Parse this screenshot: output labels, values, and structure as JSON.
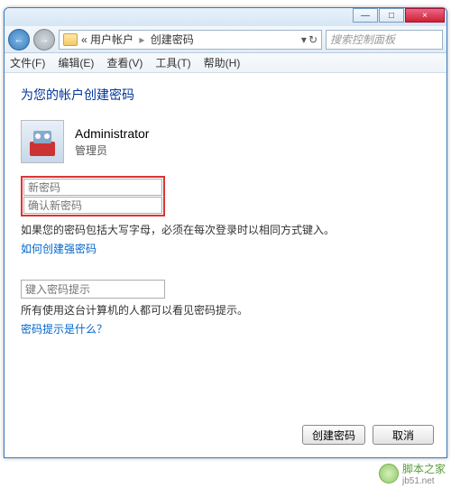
{
  "titlebar": {
    "min": "—",
    "max": "□",
    "close": "×"
  },
  "nav": {
    "back": "←",
    "forward": "→",
    "refresh": "↻",
    "dropdown": "▾"
  },
  "breadcrumb": {
    "pre": "«",
    "a": "用户帐户",
    "b": "创建密码",
    "sep": "▸"
  },
  "search": {
    "placeholder": "搜索控制面板"
  },
  "menu": {
    "file": "文件(F)",
    "edit": "编辑(E)",
    "view": "查看(V)",
    "tools": "工具(T)",
    "help": "帮助(H)"
  },
  "page": {
    "title": "为您的帐户创建密码",
    "user_name": "Administrator",
    "user_role": "管理员",
    "pw_placeholder": "新密码",
    "pw2_placeholder": "确认新密码",
    "note1": "如果您的密码包括大写字母，必须在每次登录时以相同方式键入。",
    "link1": "如何创建强密码",
    "hint_placeholder": "键入密码提示",
    "note2": "所有使用这台计算机的人都可以看见密码提示。",
    "link2": "密码提示是什么？",
    "btn_ok": "创建密码",
    "btn_cancel": "取消"
  },
  "watermark": {
    "text": "脚本之家",
    "url": "jb51.net"
  }
}
